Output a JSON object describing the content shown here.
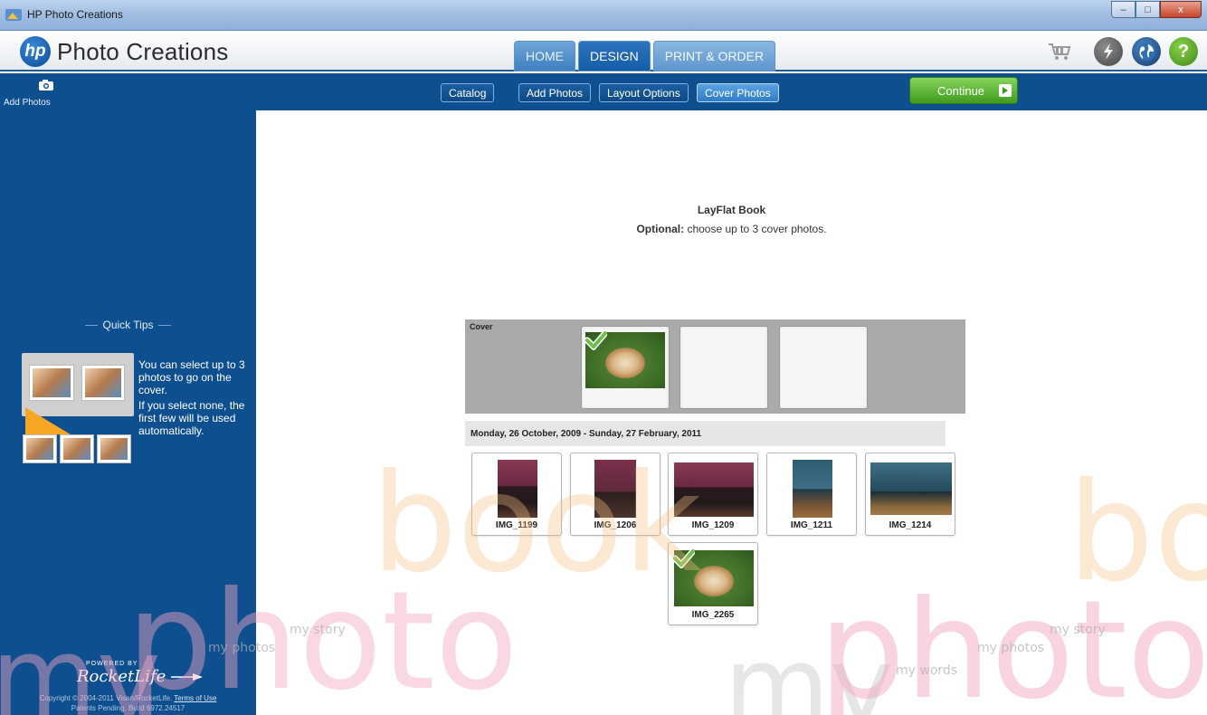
{
  "window": {
    "title": "HP Photo Creations",
    "minimize": "–",
    "maximize": "□",
    "close": "x"
  },
  "header": {
    "app_name": "Photo Creations",
    "logo_text": "hp",
    "tabs": [
      {
        "label": "HOME",
        "state": "inactive"
      },
      {
        "label": "DESIGN",
        "state": "active"
      },
      {
        "label": "PRINT & ORDER",
        "state": "faded"
      }
    ],
    "icons": [
      "cart-icon",
      "flash-icon",
      "globe-icon",
      "help-icon"
    ]
  },
  "toolbar": {
    "add_photos_label": "Add Photos",
    "buttons": [
      {
        "label": "Catalog",
        "active": false
      },
      {
        "label": "Add Photos",
        "active": false
      },
      {
        "label": "Layout Options",
        "active": false
      },
      {
        "label": "Cover Photos",
        "active": true
      }
    ],
    "continue_label": "Continue"
  },
  "sidebar": {
    "quick_tips_title": "Quick Tips",
    "tip_1": "You can select up to 3 photos to go on the cover.",
    "tip_2": "If you select none, the first few will be used automatically.",
    "powered_by": "POWERED BY",
    "brand": "RocketLife",
    "copyright": "Copyright © 2004-2011 Visan/RocketLife.",
    "terms_link": "Terms of Use",
    "build": "Patents Pending. Build 6972.24517"
  },
  "main": {
    "book_title": "LayFlat Book",
    "optional_label": "Optional:",
    "optional_text": "choose up to 3 cover photos.",
    "cover_label": "Cover",
    "date_range": "Monday, 26 October, 2009 - Sunday, 27 February, 2011",
    "photos": [
      {
        "name": "IMG_1199",
        "selected": false
      },
      {
        "name": "IMG_1206",
        "selected": false
      },
      {
        "name": "IMG_1209",
        "selected": false
      },
      {
        "name": "IMG_1211",
        "selected": false
      },
      {
        "name": "IMG_1214",
        "selected": false
      },
      {
        "name": "IMG_2265",
        "selected": true
      }
    ]
  },
  "watermark": {
    "my": "my",
    "photo": "photo",
    "book": "book",
    "story": "my story",
    "photos": "my photos",
    "words": "my words"
  },
  "colors": {
    "sidebar": "#0d4f8f",
    "tab_active": "#135da8",
    "continue": "#3f9a1d",
    "check": "#6cc04a",
    "watermark_pink": "#f5a8c6",
    "watermark_orange": "#f8c184"
  }
}
